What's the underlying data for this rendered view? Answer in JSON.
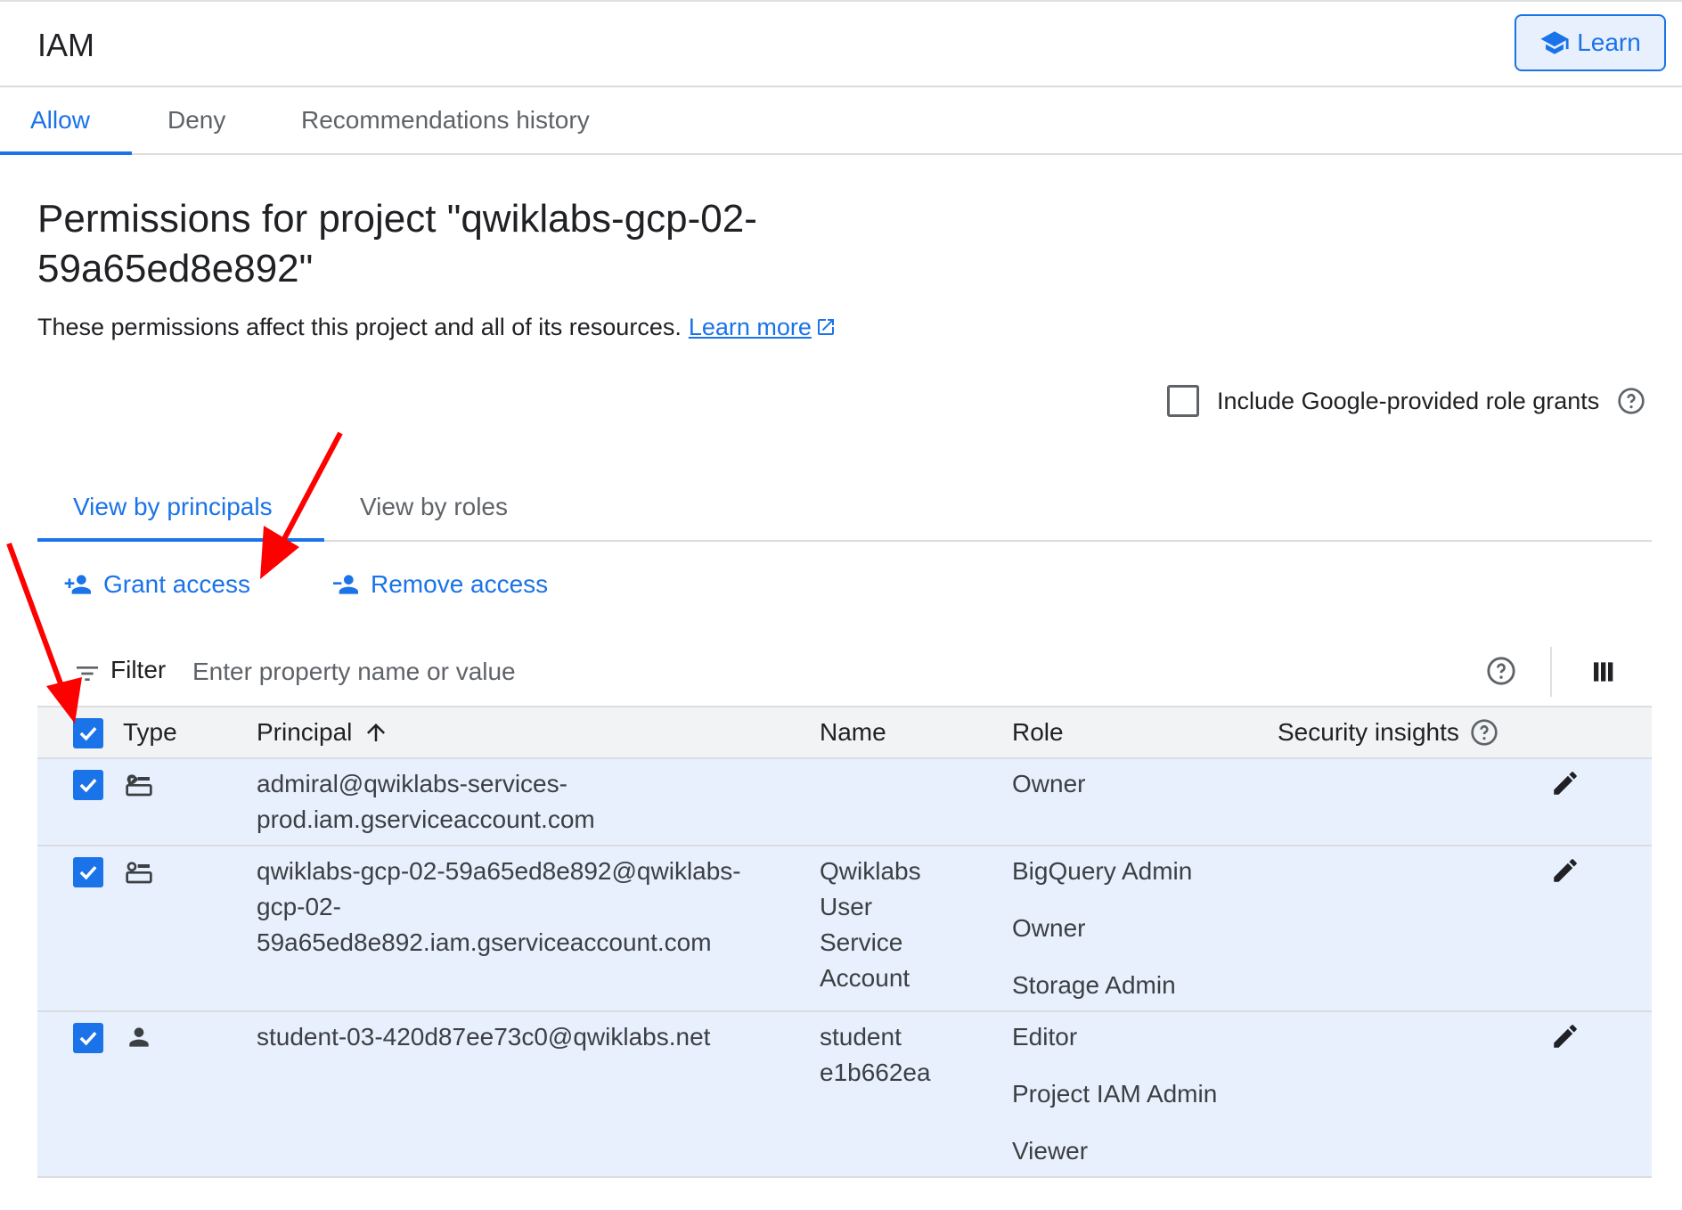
{
  "header": {
    "title": "IAM",
    "learn_label": "Learn"
  },
  "tabs": [
    {
      "label": "Allow"
    },
    {
      "label": "Deny"
    },
    {
      "label": "Recommendations history"
    }
  ],
  "page": {
    "title": "Permissions for project \"qwiklabs-gcp-02-59a65ed8e892\"",
    "description": "These permissions affect this project and all of its resources.",
    "learn_more": "Learn more",
    "include_google_label": "Include Google-provided role grants"
  },
  "subtabs": [
    {
      "label": "View by principals"
    },
    {
      "label": "View by roles"
    }
  ],
  "actions": {
    "grant": "Grant access",
    "remove": "Remove access"
  },
  "filter": {
    "label": "Filter",
    "placeholder": "Enter property name or value"
  },
  "table": {
    "headers": {
      "type": "Type",
      "principal": "Principal",
      "name": "Name",
      "role": "Role",
      "security": "Security insights"
    },
    "rows": [
      {
        "type_icon": "service-account-icon",
        "principal": "admiral@qwiklabs-services-prod.iam.gserviceaccount.com",
        "principal_lines": [
          "admiral@qwiklabs-services-",
          "prod.iam.gserviceaccount.com"
        ],
        "name_lines": [],
        "roles": [
          "Owner"
        ]
      },
      {
        "type_icon": "service-account-icon",
        "principal": "qwiklabs-gcp-02-59a65ed8e892@qwiklabs-gcp-02-59a65ed8e892.iam.gserviceaccount.com",
        "principal_lines": [
          "qwiklabs-gcp-02-59a65ed8e892@qwiklabs-",
          "gcp-02-",
          "59a65ed8e892.iam.gserviceaccount.com"
        ],
        "name_lines": [
          "Qwiklabs",
          "User",
          "Service",
          "Account"
        ],
        "roles": [
          "BigQuery Admin",
          "Owner",
          "Storage Admin"
        ]
      },
      {
        "type_icon": "person-icon",
        "principal": "student-03-420d87ee73c0@qwiklabs.net",
        "principal_lines": [
          "student-03-420d87ee73c0@qwiklabs.net"
        ],
        "name_lines": [
          "student",
          "e1b662ea"
        ],
        "roles": [
          "Editor",
          "Project IAM Admin",
          "Viewer"
        ]
      }
    ]
  },
  "colors": {
    "accent": "#1a73e8",
    "selected_row": "#e8f0fe",
    "annotation_arrow": "#ff0000"
  }
}
